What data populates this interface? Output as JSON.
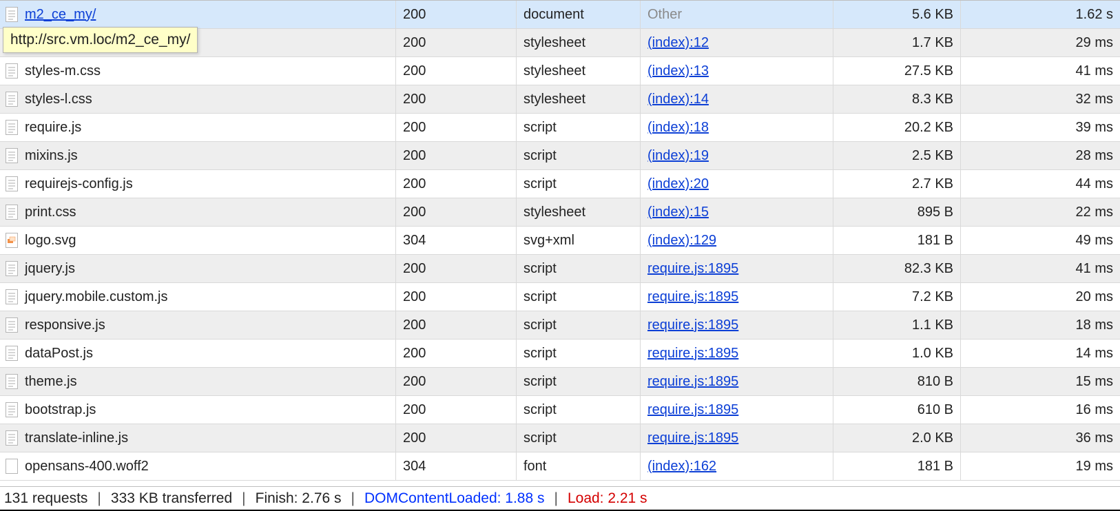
{
  "tooltip": "http://src.vm.loc/m2_ce_my/",
  "rows": [
    {
      "name": "m2_ce_my/",
      "status": "200",
      "type": "document",
      "initiator": "Other",
      "initiator_kind": "other",
      "size": "5.6 KB",
      "time": "1.62 s",
      "selected": true,
      "name_link": true,
      "icon": "doc"
    },
    {
      "name": "",
      "status": "200",
      "type": "stylesheet",
      "initiator": "(index):12",
      "initiator_kind": "link",
      "size": "1.7 KB",
      "time": "29 ms",
      "selected": false,
      "name_link": false,
      "icon": "doc"
    },
    {
      "name": "styles-m.css",
      "status": "200",
      "type": "stylesheet",
      "initiator": "(index):13",
      "initiator_kind": "link",
      "size": "27.5 KB",
      "time": "41 ms",
      "selected": false,
      "name_link": false,
      "icon": "doc"
    },
    {
      "name": "styles-l.css",
      "status": "200",
      "type": "stylesheet",
      "initiator": "(index):14",
      "initiator_kind": "link",
      "size": "8.3 KB",
      "time": "32 ms",
      "selected": false,
      "name_link": false,
      "icon": "doc"
    },
    {
      "name": "require.js",
      "status": "200",
      "type": "script",
      "initiator": "(index):18",
      "initiator_kind": "link",
      "size": "20.2 KB",
      "time": "39 ms",
      "selected": false,
      "name_link": false,
      "icon": "doc"
    },
    {
      "name": "mixins.js",
      "status": "200",
      "type": "script",
      "initiator": "(index):19",
      "initiator_kind": "link",
      "size": "2.5 KB",
      "time": "28 ms",
      "selected": false,
      "name_link": false,
      "icon": "doc"
    },
    {
      "name": "requirejs-config.js",
      "status": "200",
      "type": "script",
      "initiator": "(index):20",
      "initiator_kind": "link",
      "size": "2.7 KB",
      "time": "44 ms",
      "selected": false,
      "name_link": false,
      "icon": "doc"
    },
    {
      "name": "print.css",
      "status": "200",
      "type": "stylesheet",
      "initiator": "(index):15",
      "initiator_kind": "link",
      "size": "895 B",
      "time": "22 ms",
      "selected": false,
      "name_link": false,
      "icon": "doc"
    },
    {
      "name": "logo.svg",
      "status": "304",
      "type": "svg+xml",
      "initiator": "(index):129",
      "initiator_kind": "link",
      "size": "181 B",
      "time": "49 ms",
      "selected": false,
      "name_link": false,
      "icon": "img"
    },
    {
      "name": "jquery.js",
      "status": "200",
      "type": "script",
      "initiator": "require.js:1895",
      "initiator_kind": "link",
      "size": "82.3 KB",
      "time": "41 ms",
      "selected": false,
      "name_link": false,
      "icon": "doc"
    },
    {
      "name": "jquery.mobile.custom.js",
      "status": "200",
      "type": "script",
      "initiator": "require.js:1895",
      "initiator_kind": "link",
      "size": "7.2 KB",
      "time": "20 ms",
      "selected": false,
      "name_link": false,
      "icon": "doc"
    },
    {
      "name": "responsive.js",
      "status": "200",
      "type": "script",
      "initiator": "require.js:1895",
      "initiator_kind": "link",
      "size": "1.1 KB",
      "time": "18 ms",
      "selected": false,
      "name_link": false,
      "icon": "doc"
    },
    {
      "name": "dataPost.js",
      "status": "200",
      "type": "script",
      "initiator": "require.js:1895",
      "initiator_kind": "link",
      "size": "1.0 KB",
      "time": "14 ms",
      "selected": false,
      "name_link": false,
      "icon": "doc"
    },
    {
      "name": "theme.js",
      "status": "200",
      "type": "script",
      "initiator": "require.js:1895",
      "initiator_kind": "link",
      "size": "810 B",
      "time": "15 ms",
      "selected": false,
      "name_link": false,
      "icon": "doc"
    },
    {
      "name": "bootstrap.js",
      "status": "200",
      "type": "script",
      "initiator": "require.js:1895",
      "initiator_kind": "link",
      "size": "610 B",
      "time": "16 ms",
      "selected": false,
      "name_link": false,
      "icon": "doc"
    },
    {
      "name": "translate-inline.js",
      "status": "200",
      "type": "script",
      "initiator": "require.js:1895",
      "initiator_kind": "link",
      "size": "2.0 KB",
      "time": "36 ms",
      "selected": false,
      "name_link": false,
      "icon": "doc"
    },
    {
      "name": "opensans-400.woff2",
      "status": "304",
      "type": "font",
      "initiator": "(index):162",
      "initiator_kind": "link",
      "size": "181 B",
      "time": "19 ms",
      "selected": false,
      "name_link": false,
      "icon": "blank"
    }
  ],
  "statusbar": {
    "requests": "131 requests",
    "transferred": "333 KB transferred",
    "finish": "Finish: 2.76 s",
    "dom": "DOMContentLoaded: 1.88 s",
    "load": "Load: 2.21 s"
  }
}
